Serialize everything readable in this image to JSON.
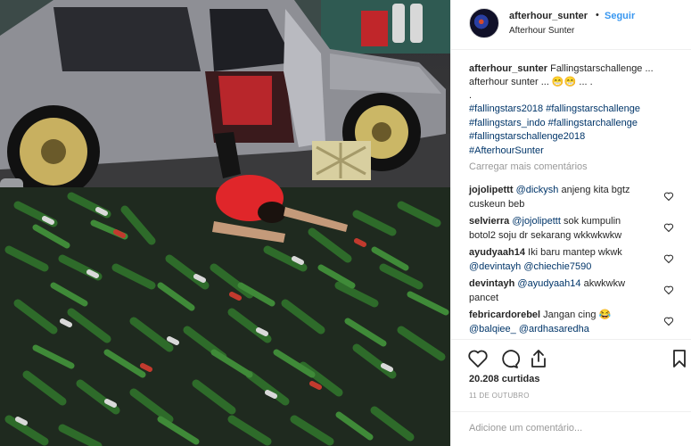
{
  "header": {
    "username": "afterhour_sunter",
    "dot": "•",
    "follow_label": "Seguir",
    "location": "Afterhour Sunter"
  },
  "caption": {
    "username": "afterhour_sunter",
    "text_line1": "Fallingstarschallenge ...",
    "text_line2": "afterhour sunter ... 😁😁 ... .",
    "text_line3": ".",
    "hashtags": [
      "#fallingstars2018 #fallingstarschallenge",
      "#fallingstars_indo #fallingstarchallenge",
      "#fallingstarschallenge2018",
      "#AfterhourSunter"
    ]
  },
  "load_more": "Carregar mais comentários",
  "comments": [
    {
      "user": "jojolipettt",
      "mention": "@dickysh",
      "text": " anjeng kita bgtz",
      "line2": "cuskeun beb"
    },
    {
      "user": "selvierra",
      "mention": "@jojolipettt",
      "text": " sok kumpulin",
      "line2": "botol2 soju dr sekarang wkkwkwkw"
    },
    {
      "user": "ayudyaah14",
      "mention": "",
      "text": "Iki baru mantep wkwk",
      "line2_mention1": "@devintayh",
      "line2_mention2": "@chiechie7590"
    },
    {
      "user": "devintayh",
      "mention": "@ayudyaah14",
      "text": " akwkwkw",
      "line2": "pancet"
    },
    {
      "user": "febricardorebel",
      "mention": "",
      "text": "Jangan cing 😂",
      "line2_mention1": "@balqiee_",
      "line2_mention2": "@ardhasaredha"
    }
  ],
  "likes": "20.208 curtidas",
  "date": "11 DE OUTUBRO",
  "add_comment_placeholder": "Adicione um comentário...",
  "icons": {
    "like": "heart-icon",
    "comment": "comment-icon",
    "share": "share-icon",
    "save": "bookmark-icon"
  },
  "colors": {
    "link": "#003569",
    "follow": "#3897f0",
    "muted": "#999999"
  }
}
